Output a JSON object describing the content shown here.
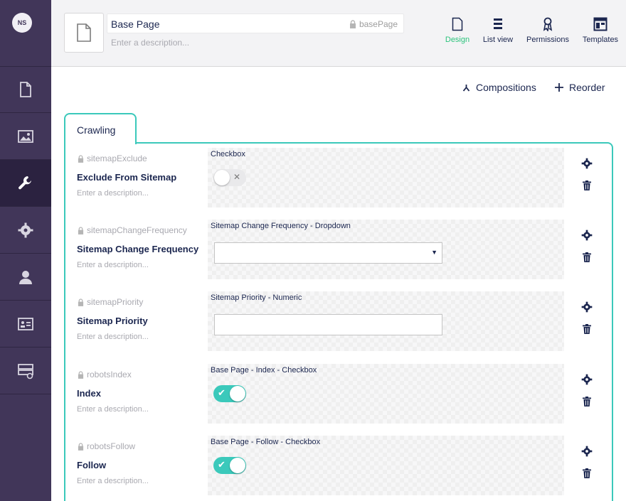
{
  "user": {
    "initials": "NS"
  },
  "sidebar": {
    "items": [
      {
        "icon": "content-icon"
      },
      {
        "icon": "media-icon"
      },
      {
        "icon": "settings-wrench-icon",
        "active": true
      },
      {
        "icon": "gear-icon"
      },
      {
        "icon": "member-icon"
      },
      {
        "icon": "forms-icon"
      },
      {
        "icon": "deploy-icon"
      }
    ]
  },
  "header": {
    "name": "Base Page",
    "alias": "basePage",
    "description_placeholder": "Enter a description...",
    "apps": [
      {
        "label": "Design",
        "icon": "document-icon",
        "active": true
      },
      {
        "label": "List view",
        "icon": "list-icon"
      },
      {
        "label": "Permissions",
        "icon": "permissions-icon"
      },
      {
        "label": "Templates",
        "icon": "templates-icon"
      }
    ]
  },
  "actions": {
    "compositions": "Compositions",
    "reorder": "Reorder"
  },
  "group": {
    "name": "Crawling",
    "properties": [
      {
        "alias": "sitemapExclude",
        "label": "Exclude From Sitemap",
        "description": "Enter a description...",
        "editor": "Checkbox",
        "type": "toggle",
        "value": false
      },
      {
        "alias": "sitemapChangeFrequency",
        "label": "Sitemap Change Frequency",
        "description": "Enter a description...",
        "editor": "Sitemap Change Frequency - Dropdown",
        "type": "dropdown",
        "value": ""
      },
      {
        "alias": "sitemapPriority",
        "label": "Sitemap Priority",
        "description": "Enter a description...",
        "editor": "Sitemap Priority - Numeric",
        "type": "numeric",
        "value": ""
      },
      {
        "alias": "robotsIndex",
        "label": "Index",
        "description": "Enter a description...",
        "editor": "Base Page - Index - Checkbox",
        "type": "toggle",
        "value": true
      },
      {
        "alias": "robotsFollow",
        "label": "Follow",
        "description": "Enter a description...",
        "editor": "Base Page - Follow - Checkbox",
        "type": "toggle",
        "value": true
      }
    ]
  },
  "colors": {
    "sidebar": "#413659",
    "accent": "#3bc9bb",
    "active_app": "#2bc37c"
  }
}
